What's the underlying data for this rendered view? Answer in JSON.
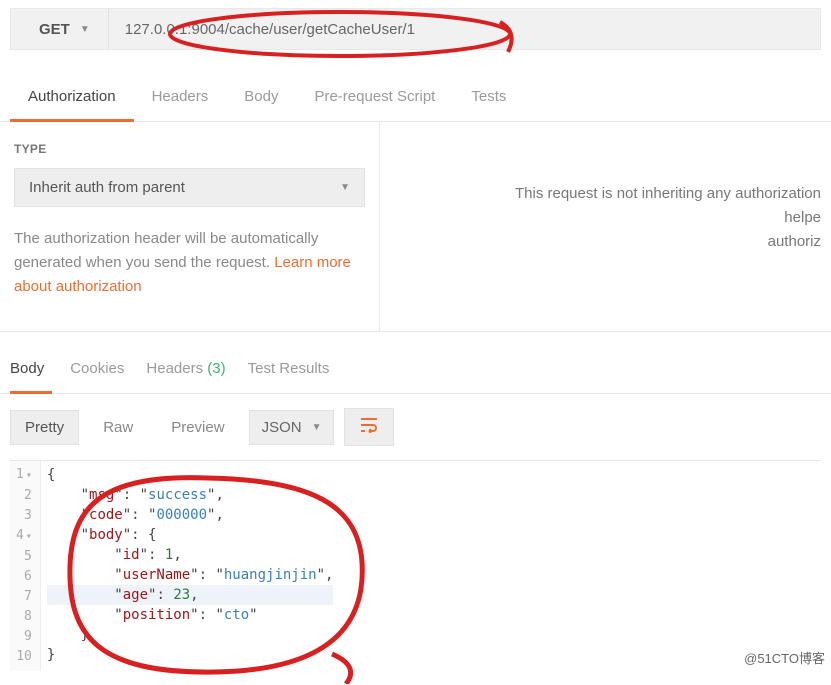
{
  "request": {
    "method": "GET",
    "url": "127.0.0.1:9004/cache/user/getCacheUser/1"
  },
  "reqTabs": [
    "Authorization",
    "Headers",
    "Body",
    "Pre-request Script",
    "Tests"
  ],
  "auth": {
    "typeLabel": "TYPE",
    "typeValue": "Inherit auth from parent",
    "desc1": "The authorization header will be automatically generated when you send the request. ",
    "link": "Learn more about authorization",
    "rightMsg1": "This request is not inheriting any authorization helpe",
    "rightMsg2": "authoriz"
  },
  "respTabs": {
    "body": "Body",
    "cookies": "Cookies",
    "headers": "Headers",
    "headerCount": "(3)",
    "testResults": "Test Results"
  },
  "viewBar": {
    "pretty": "Pretty",
    "raw": "Raw",
    "preview": "Preview",
    "format": "JSON"
  },
  "code": {
    "l1": "{",
    "l2a": "    \"",
    "l2b": "msg",
    "l2c": "\": \"",
    "l2d": "success",
    "l2e": "\",",
    "l3a": "    \"",
    "l3b": "code",
    "l3c": "\": \"",
    "l3d": "000000",
    "l3e": "\",",
    "l4a": "    \"",
    "l4b": "body",
    "l4c": "\": {",
    "l5a": "        \"",
    "l5b": "id",
    "l5c": "\": ",
    "l5d": "1",
    "l5e": ",",
    "l6a": "        \"",
    "l6b": "userName",
    "l6c": "\": \"",
    "l6d": "huangjinjin",
    "l6e": "\",",
    "l7a": "        \"",
    "l7b": "age",
    "l7c": "\": ",
    "l7d": "23",
    "l7e": ",",
    "l8a": "        \"",
    "l8b": "position",
    "l8c": "\": \"",
    "l8d": "cto",
    "l8e": "\"",
    "l9": "    }",
    "l10": "}"
  },
  "lineNums": [
    "1",
    "2",
    "3",
    "4",
    "5",
    "6",
    "7",
    "8",
    "9",
    "10"
  ],
  "watermark": "@51CTO博客"
}
